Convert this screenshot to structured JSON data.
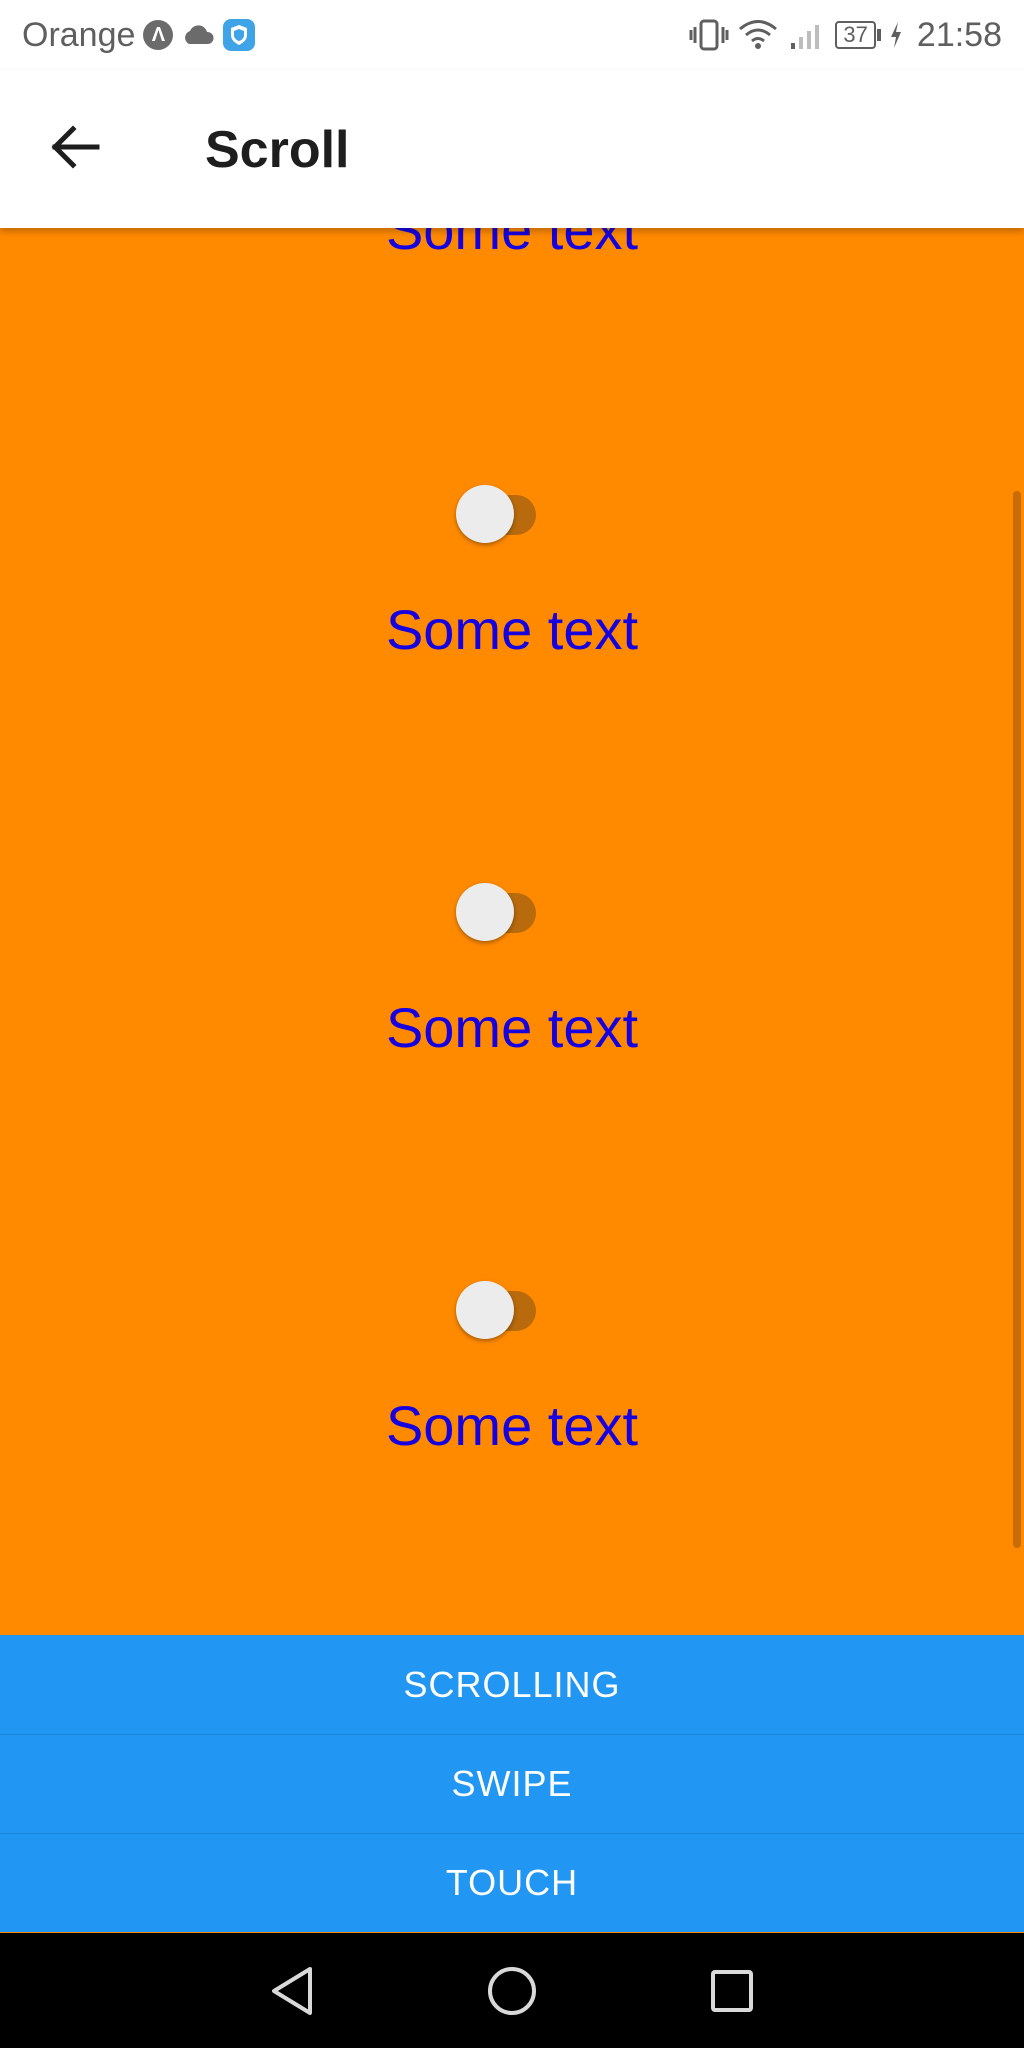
{
  "status_bar": {
    "carrier": "Orange",
    "battery_level": "37",
    "time": "21:58",
    "icons": [
      "app-badge-icon",
      "cloud-icon",
      "shield-icon",
      "vibrate-icon",
      "wifi-icon",
      "signal-icon",
      "battery-icon",
      "charging-icon"
    ]
  },
  "app_bar": {
    "title": "Scroll",
    "back_icon": "arrow-left-icon"
  },
  "content": {
    "items": [
      {
        "text": "Some text",
        "switch_on": false
      },
      {
        "text": "Some text",
        "switch_on": false
      },
      {
        "text": "Some text",
        "switch_on": false
      },
      {
        "text": "Some text",
        "switch_on": false
      }
    ],
    "text_color": "#1600E0",
    "background_color": "#FF8A00"
  },
  "buttons": {
    "scrolling": "SCROLLING",
    "swipe": "SWIPE",
    "touch": "TOUCH",
    "color": "#2196F3"
  },
  "nav_bar": {
    "icons": [
      "back-triangle-icon",
      "home-circle-icon",
      "recents-square-icon"
    ]
  }
}
